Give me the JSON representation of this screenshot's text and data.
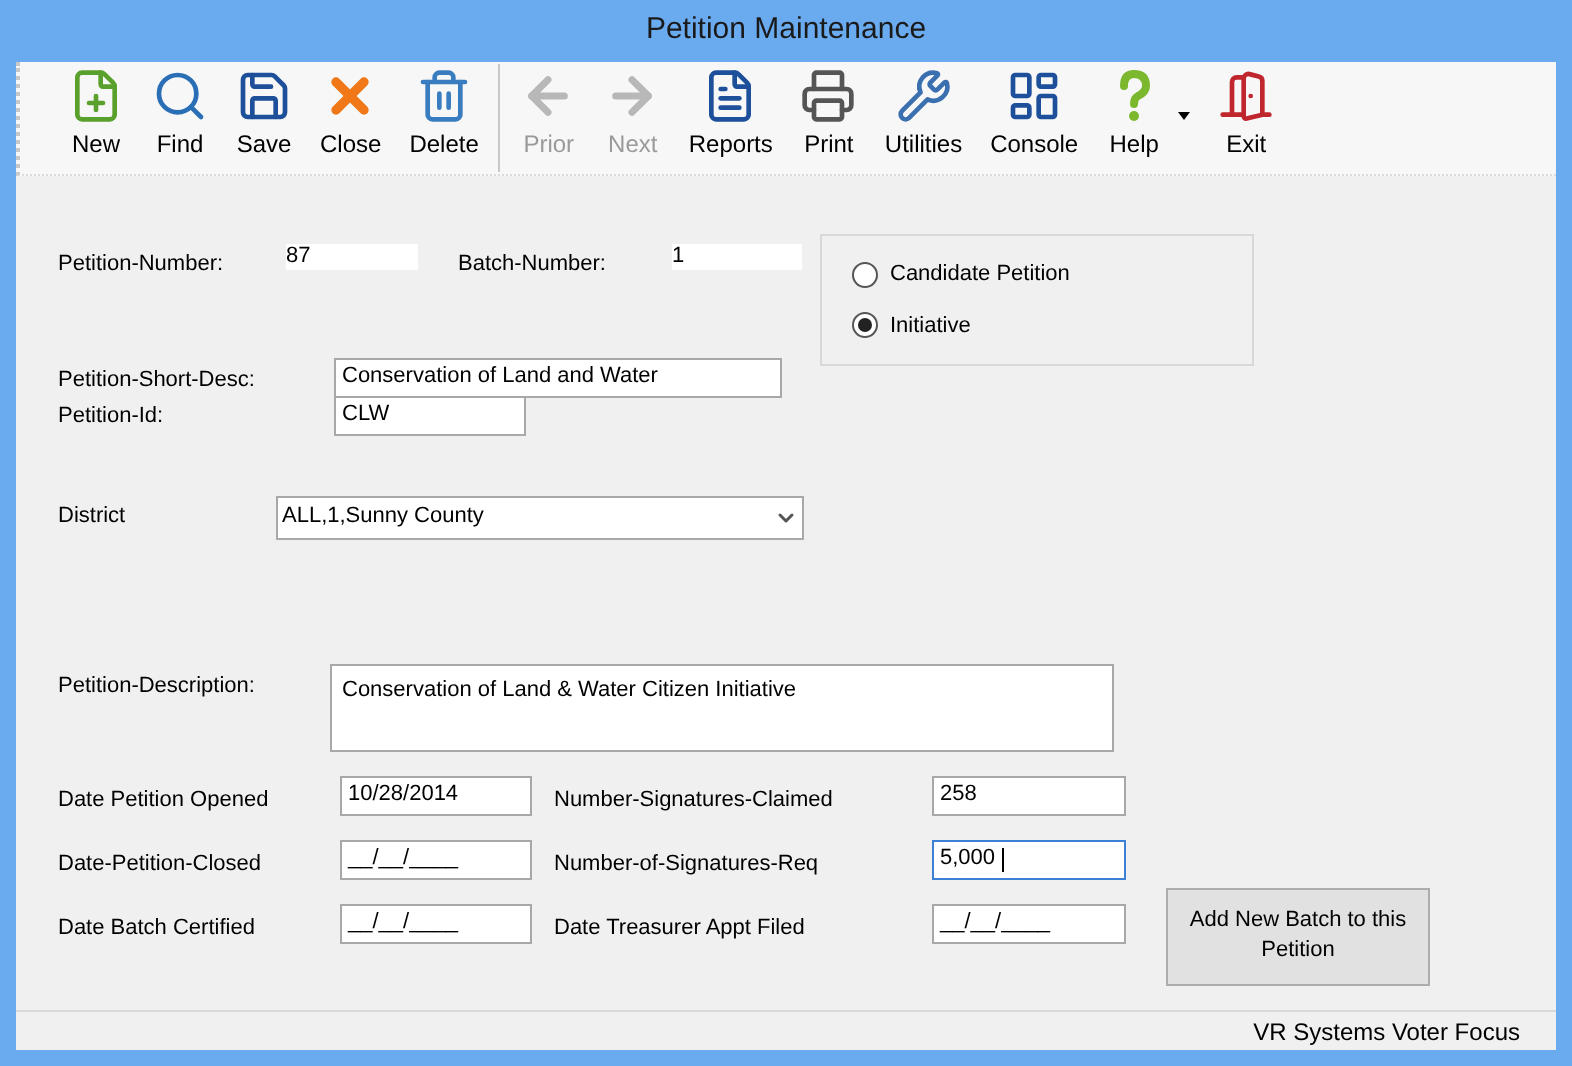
{
  "window": {
    "title": "Petition Maintenance"
  },
  "toolbar": {
    "groups": [
      [
        {
          "label": "New",
          "kind": "new",
          "disabled": false,
          "dropdown": false
        },
        {
          "label": "Find",
          "kind": "find",
          "disabled": false,
          "dropdown": false
        },
        {
          "label": "Save",
          "kind": "save",
          "disabled": false,
          "dropdown": false
        },
        {
          "label": "Close",
          "kind": "close",
          "disabled": false,
          "dropdown": false
        },
        {
          "label": "Delete",
          "kind": "delete",
          "disabled": false,
          "dropdown": false
        }
      ],
      [
        {
          "label": "Prior",
          "kind": "prior",
          "disabled": true,
          "dropdown": false
        },
        {
          "label": "Next",
          "kind": "next",
          "disabled": true,
          "dropdown": false
        },
        {
          "label": "Reports",
          "kind": "reports",
          "disabled": false,
          "dropdown": false
        },
        {
          "label": "Print",
          "kind": "print",
          "disabled": false,
          "dropdown": false
        },
        {
          "label": "Utilities",
          "kind": "utilities",
          "disabled": false,
          "dropdown": false
        },
        {
          "label": "Console",
          "kind": "console",
          "disabled": false,
          "dropdown": false
        },
        {
          "label": "Help",
          "kind": "help",
          "disabled": false,
          "dropdown": true
        },
        {
          "label": "Exit",
          "kind": "exit",
          "disabled": false,
          "dropdown": false
        }
      ]
    ]
  },
  "form": {
    "petition_number": {
      "label": "Petition-Number:",
      "value": "87"
    },
    "batch_number": {
      "label": "Batch-Number:",
      "value": "1"
    },
    "petition_type": [
      {
        "label": "Candidate Petition",
        "selected": false
      },
      {
        "label": "Initiative",
        "selected": true
      }
    ],
    "short_desc": {
      "label": "Petition-Short-Desc:",
      "value": "Conservation of Land and Water"
    },
    "petition_id": {
      "label": "Petition-Id:",
      "value": "CLW"
    },
    "district": {
      "label": "District",
      "value": "ALL,1,Sunny County"
    },
    "description": {
      "label": "Petition-Description:",
      "value": "Conservation of Land & Water Citizen Initiative"
    },
    "rows": [
      [
        {
          "label": "Date Petition Opened",
          "value": "10/28/2014",
          "focused": false
        },
        {
          "label": "Number-Signatures-Claimed",
          "value": "258",
          "focused": false
        }
      ],
      [
        {
          "label": "Date-Petition-Closed",
          "value": "__/__/____",
          "focused": false
        },
        {
          "label": "Number-of-Signatures-Req",
          "value": "5,000",
          "focused": true
        }
      ],
      [
        {
          "label": "Date Batch Certified",
          "value": "__/__/____",
          "focused": false
        },
        {
          "label": "Date Treasurer Appt Filed",
          "value": "__/__/____",
          "focused": false
        }
      ]
    ],
    "add_batch_button": "Add New Batch to this Petition"
  },
  "status_bar": "VR Systems Voter Focus"
}
